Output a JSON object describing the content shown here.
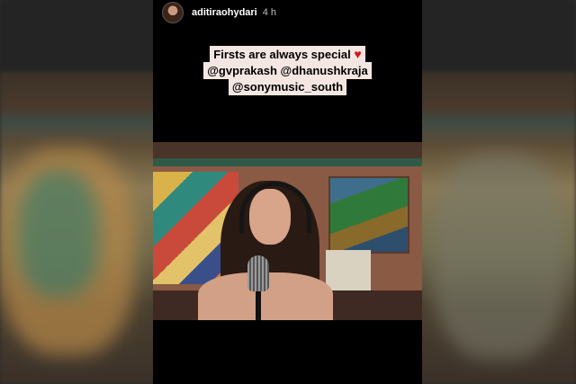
{
  "story": {
    "username": "aditiraohydari",
    "time": "4 h",
    "caption": {
      "line1": "Firsts are always special",
      "heart": "♥",
      "line2": "@gvprakash @dhanushkraja",
      "line3": "@sonymusic_south"
    }
  },
  "icons": {
    "avatar": "profile-avatar",
    "heart": "heart-icon"
  },
  "colors": {
    "caption_bg": "#f4e7e3",
    "heart": "#d8141f",
    "story_bg": "#000000"
  }
}
